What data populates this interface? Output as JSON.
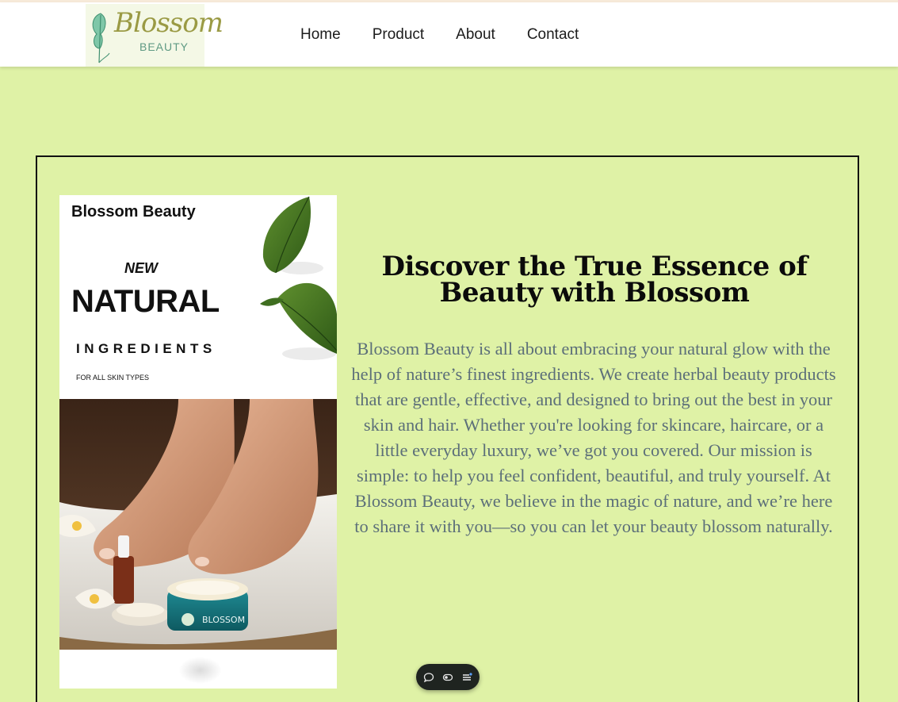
{
  "header": {
    "logo": {
      "script": "Blossom",
      "subtitle": "BEAUTY"
    },
    "nav": [
      "Home",
      "Product",
      "About",
      "Contact"
    ]
  },
  "promo": {
    "brand": "Blossom Beauty",
    "new": "NEW",
    "headline": "NATURAL",
    "subheadline": "INGREDIENTS",
    "tagline": "FOR ALL SKIN TYPES",
    "jar_label": "BLOSSOM"
  },
  "hero": {
    "heading": "Discover the True Essence of Beauty with Blossom",
    "description": "Blossom Beauty is all about embracing your natural glow with the help of nature’s finest ingredients. We create herbal beauty products that are gentle, effective, and designed to bring out the best in your skin and hair. Whether you're looking for skincare, haircare, or a little everyday luxury, we’ve got you covered. Our mission is simple: to help you feel confident, beautiful, and truly yourself. At Blossom Beauty, we believe in the magic of nature, and we’re here to share it with you—so you can let your beauty blossom naturally."
  },
  "toolbar": {
    "icons": [
      "comment-icon",
      "toggle-icon",
      "menu-icon"
    ]
  },
  "colors": {
    "page_background": "#dff2a6",
    "header_background": "#ffffff",
    "description_text": "#5c6f79",
    "toolbar_background": "#1f2420"
  }
}
